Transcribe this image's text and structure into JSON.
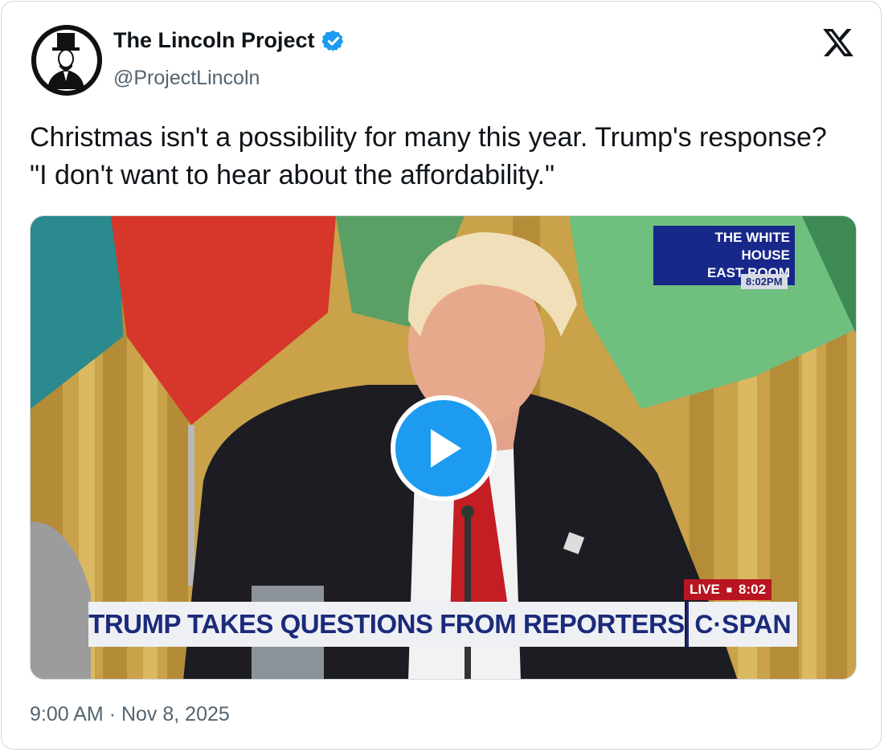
{
  "author": {
    "display_name": "The Lincoln Project",
    "handle": "@ProjectLincoln",
    "verified": true,
    "avatar_icon": "lincoln-portrait-avatar"
  },
  "platform_icon": "x-logo-icon",
  "tweet": {
    "text": "Christmas isn't a possibility for many this year. Trump's response? \"I don't want to hear about the affordability.\""
  },
  "video": {
    "location_line1": "THE WHITE HOUSE",
    "location_line2": "EAST ROOM",
    "location_time": "8:02PM",
    "live_label": "LIVE",
    "live_time": "8:02",
    "chyron": "TRUMP TAKES QUESTIONS FROM REPORTERS",
    "network": "C·SPAN",
    "play_icon": "play-icon"
  },
  "timestamp": {
    "time": "9:00 AM",
    "separator": "·",
    "date": "Nov 8, 2025"
  },
  "colors": {
    "accent": "#1d9bf0",
    "text_primary": "#0f1419",
    "text_secondary": "#536471",
    "border": "#cfd9de"
  }
}
